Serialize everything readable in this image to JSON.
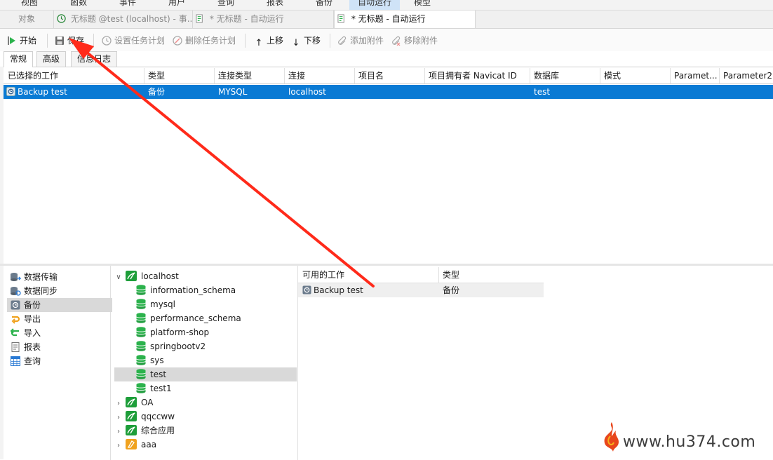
{
  "menubar": {
    "items": [
      "视图",
      "函数",
      "事件",
      "用户",
      "查询",
      "报表",
      "备份",
      "自动运行",
      "模型"
    ],
    "active_index": 7
  },
  "doc_tabs": [
    {
      "label": "对象",
      "state": "inactive"
    },
    {
      "label": "无标题 @test (localhost) - 事...",
      "state": "inactive",
      "icon": "clock-icon"
    },
    {
      "label": "* 无标题 - 自动运行",
      "state": "inactive",
      "icon": "batch-job-icon"
    },
    {
      "label": "* 无标题 - 自动运行",
      "state": "active",
      "icon": "batch-job-icon"
    }
  ],
  "toolbar": {
    "start": "开始",
    "save": "保存",
    "set_schedule": "设置任务计划",
    "delete_schedule": "删除任务计划",
    "move_up": "上移",
    "move_down": "下移",
    "add_attachment": "添加附件",
    "remove_attachment": "移除附件"
  },
  "subtabs": [
    "常规",
    "高级",
    "信息日志"
  ],
  "selected_jobs": {
    "columns": [
      "已选择的工作",
      "类型",
      "连接类型",
      "连接",
      "项目名",
      "项目拥有者 Navicat ID",
      "数据库",
      "模式",
      "Paramet...",
      "Parameter2"
    ],
    "rows": [
      [
        "Backup test",
        "备份",
        "MYSQL",
        "localhost",
        "",
        "",
        "test",
        "",
        "",
        ""
      ]
    ]
  },
  "categories": [
    {
      "label": "数据传输",
      "icon": "data-transfer-icon"
    },
    {
      "label": "数据同步",
      "icon": "data-sync-icon"
    },
    {
      "label": "备份",
      "icon": "backup-icon",
      "selected": true
    },
    {
      "label": "导出",
      "icon": "export-icon"
    },
    {
      "label": "导入",
      "icon": "import-icon"
    },
    {
      "label": "报表",
      "icon": "report-icon"
    },
    {
      "label": "查询",
      "icon": "query-icon"
    }
  ],
  "tree": {
    "connection": "localhost",
    "databases": [
      "information_schema",
      "mysql",
      "performance_schema",
      "platform-shop",
      "springbootv2",
      "sys",
      "test",
      "test1"
    ],
    "selected_database": "test",
    "other_connections": [
      "OA",
      "qqccww",
      "综合应用",
      "aaa"
    ]
  },
  "available_jobs": {
    "columns": [
      "可用的工作",
      "类型"
    ],
    "rows": [
      [
        "Backup test",
        "备份"
      ]
    ]
  },
  "watermark": "www.hu374.com",
  "colors": {
    "selection_blue": "#0a7ad4",
    "db_green": "#2bb24c",
    "mysql_conn_green": "#1e9e3a",
    "annotation_red": "#ff2a1a"
  }
}
